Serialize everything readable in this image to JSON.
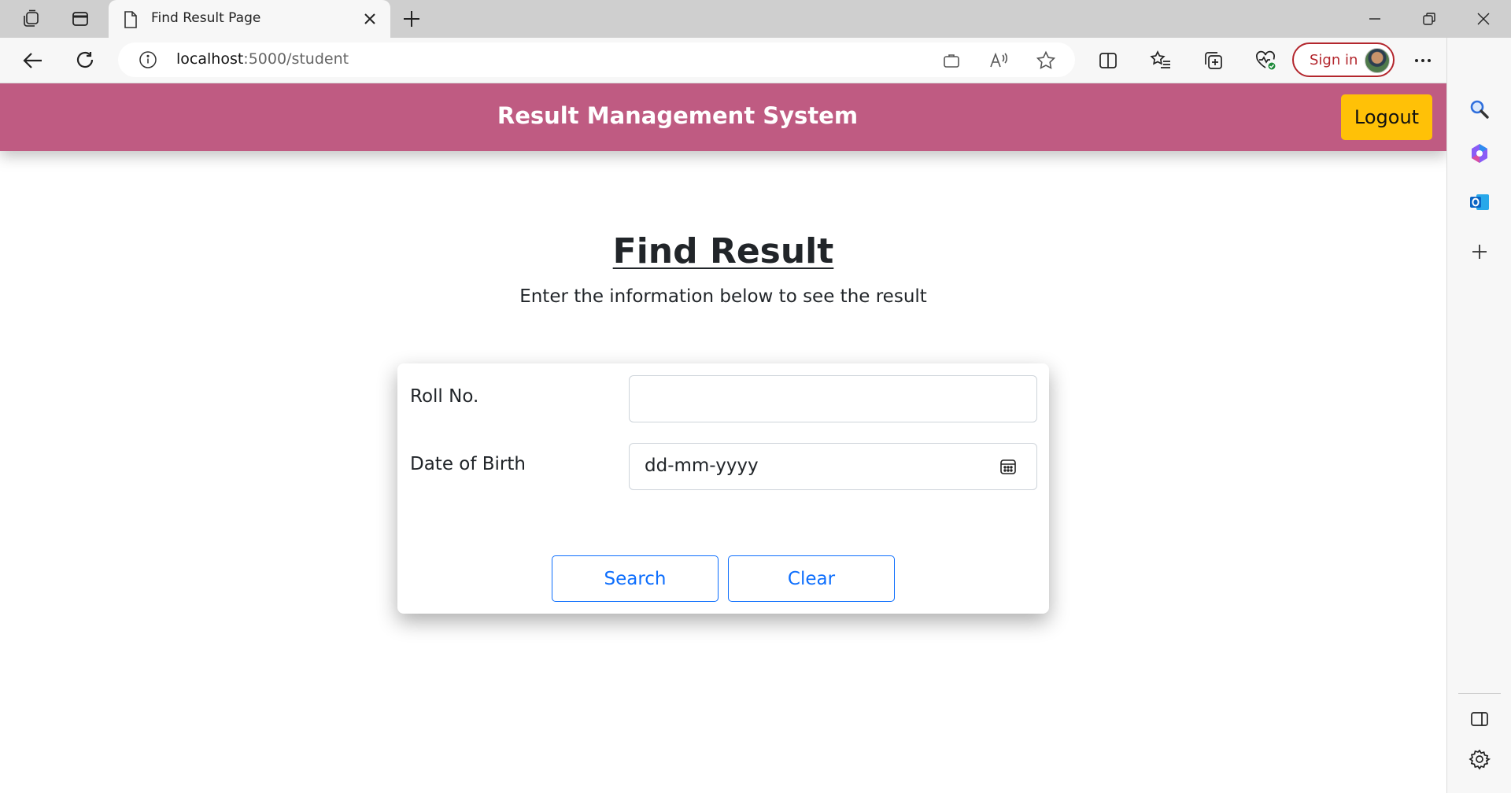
{
  "browser": {
    "tab": {
      "title": "Find Result Page"
    },
    "address": {
      "host": "localhost",
      "path": ":5000/student"
    },
    "signin_label": "Sign in"
  },
  "app": {
    "title": "Result Management System",
    "logout_label": "Logout",
    "header_color": "#bf5b82",
    "logout_color": "#ffc107"
  },
  "main": {
    "heading": "Find Result",
    "subheading": "Enter the information below to see the result",
    "form": {
      "roll_label": "Roll No.",
      "roll_value": "",
      "dob_label": "Date of Birth",
      "dob_placeholder": "dd-mm-yyyy",
      "search_label": "Search",
      "clear_label": "Clear",
      "button_color": "#0d6efd"
    }
  },
  "icons": {
    "titlebar": [
      "workspaces-icon",
      "tab-actions-icon",
      "page-icon",
      "close-icon",
      "plus-icon",
      "minimize-icon",
      "restore-icon",
      "close-window-icon"
    ],
    "toolbar": [
      "back-icon",
      "refresh-icon",
      "info-icon",
      "app-available-icon",
      "read-aloud-icon",
      "favorite-star-icon",
      "split-screen-icon",
      "favorites-icon",
      "collections-icon",
      "browser-essentials-icon",
      "more-icon",
      "bing-copilot-icon"
    ],
    "sidebar": [
      "search-icon",
      "copilot-icon",
      "outlook-icon",
      "add-icon",
      "hide-sidebar-icon",
      "settings-gear-icon"
    ]
  }
}
